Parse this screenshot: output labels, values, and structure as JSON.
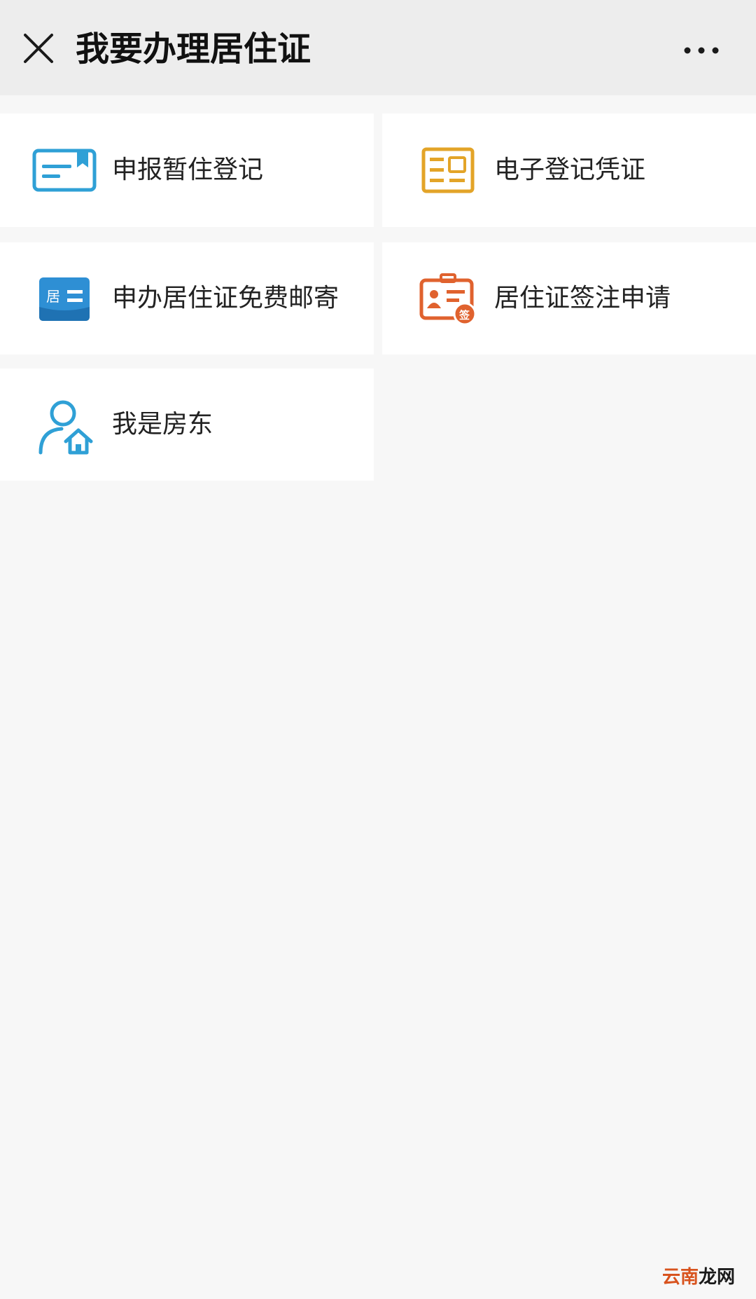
{
  "header": {
    "title": "我要办理居住证",
    "close_icon": "close-icon",
    "more_icon": "more-options-icon"
  },
  "services": [
    {
      "label": "申报暂住登记",
      "icon": "temporary-residence-card-icon",
      "color": "#2fa0d6"
    },
    {
      "label": "电子登记凭证",
      "icon": "electronic-certificate-icon",
      "color": "#e3a428"
    },
    {
      "label": "申办居住证免费邮寄",
      "icon": "residence-permit-mail-icon",
      "color": "#2e8fd4"
    },
    {
      "label": "居住证签注申请",
      "icon": "residence-permit-sign-icon",
      "color": "#e0622e"
    },
    {
      "label": "我是房东",
      "icon": "landlord-icon",
      "color": "#2fa0d6"
    }
  ],
  "watermark": {
    "part1": "云南",
    "part2": "龙网"
  }
}
